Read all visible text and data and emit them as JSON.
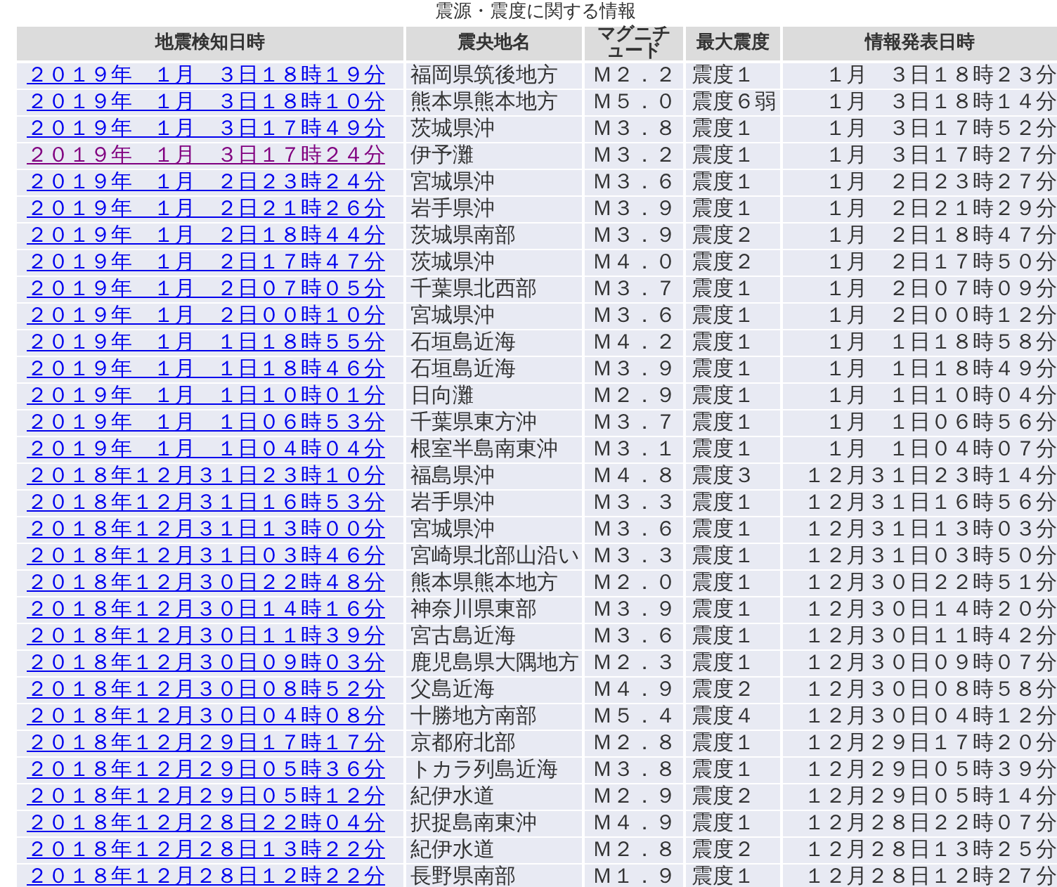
{
  "caption": "震源・震度に関する情報",
  "table": {
    "columns": [
      "地震検知日時",
      "震央地名",
      "マグニチュード",
      "最大震度",
      "情報発表日時"
    ],
    "rows": [
      {
        "detected": "２０１９年　１月　３日１８時１９分",
        "place": "福岡県筑後地方",
        "magnitude": "Ｍ２．２",
        "intensity": "震度１",
        "issued": "１月　３日１８時２３分",
        "visited": false
      },
      {
        "detected": "２０１９年　１月　３日１８時１０分",
        "place": "熊本県熊本地方",
        "magnitude": "Ｍ５．０",
        "intensity": "震度６弱",
        "issued": "１月　３日１８時１４分",
        "visited": false
      },
      {
        "detected": "２０１９年　１月　３日１７時４９分",
        "place": "茨城県沖",
        "magnitude": "Ｍ３．８",
        "intensity": "震度１",
        "issued": "１月　３日１７時５２分",
        "visited": false
      },
      {
        "detected": "２０１９年　１月　３日１７時２４分",
        "place": "伊予灘",
        "magnitude": "Ｍ３．２",
        "intensity": "震度１",
        "issued": "１月　３日１７時２７分",
        "visited": true
      },
      {
        "detected": "２０１９年　１月　２日２３時２４分",
        "place": "宮城県沖",
        "magnitude": "Ｍ３．６",
        "intensity": "震度１",
        "issued": "１月　２日２３時２７分",
        "visited": false
      },
      {
        "detected": "２０１９年　１月　２日２１時２６分",
        "place": "岩手県沖",
        "magnitude": "Ｍ３．９",
        "intensity": "震度１",
        "issued": "１月　２日２１時２９分",
        "visited": false
      },
      {
        "detected": "２０１９年　１月　２日１８時４４分",
        "place": "茨城県南部",
        "magnitude": "Ｍ３．９",
        "intensity": "震度２",
        "issued": "１月　２日１８時４７分",
        "visited": false
      },
      {
        "detected": "２０１９年　１月　２日１７時４７分",
        "place": "茨城県沖",
        "magnitude": "Ｍ４．０",
        "intensity": "震度２",
        "issued": "１月　２日１７時５０分",
        "visited": false
      },
      {
        "detected": "２０１９年　１月　２日０７時０５分",
        "place": "千葉県北西部",
        "magnitude": "Ｍ３．７",
        "intensity": "震度１",
        "issued": "１月　２日０７時０９分",
        "visited": false
      },
      {
        "detected": "２０１９年　１月　２日００時１０分",
        "place": "宮城県沖",
        "magnitude": "Ｍ３．６",
        "intensity": "震度１",
        "issued": "１月　２日００時１２分",
        "visited": false
      },
      {
        "detected": "２０１９年　１月　１日１８時５５分",
        "place": "石垣島近海",
        "magnitude": "Ｍ４．２",
        "intensity": "震度１",
        "issued": "１月　１日１８時５８分",
        "visited": false
      },
      {
        "detected": "２０１９年　１月　１日１８時４６分",
        "place": "石垣島近海",
        "magnitude": "Ｍ３．９",
        "intensity": "震度１",
        "issued": "１月　１日１８時４９分",
        "visited": false
      },
      {
        "detected": "２０１９年　１月　１日１０時０１分",
        "place": "日向灘",
        "magnitude": "Ｍ２．９",
        "intensity": "震度１",
        "issued": "１月　１日１０時０４分",
        "visited": false
      },
      {
        "detected": "２０１９年　１月　１日０６時５３分",
        "place": "千葉県東方沖",
        "magnitude": "Ｍ３．７",
        "intensity": "震度１",
        "issued": "１月　１日０６時５６分",
        "visited": false
      },
      {
        "detected": "２０１９年　１月　１日０４時０４分",
        "place": "根室半島南東沖",
        "magnitude": "Ｍ３．１",
        "intensity": "震度１",
        "issued": "１月　１日０４時０７分",
        "visited": false
      },
      {
        "detected": "２０１８年１２月３１日２３時１０分",
        "place": "福島県沖",
        "magnitude": "Ｍ４．８",
        "intensity": "震度３",
        "issued": "１２月３１日２３時１４分",
        "visited": false
      },
      {
        "detected": "２０１８年１２月３１日１６時５３分",
        "place": "岩手県沖",
        "magnitude": "Ｍ３．３",
        "intensity": "震度１",
        "issued": "１２月３１日１６時５６分",
        "visited": false
      },
      {
        "detected": "２０１８年１２月３１日１３時００分",
        "place": "宮城県沖",
        "magnitude": "Ｍ３．６",
        "intensity": "震度１",
        "issued": "１２月３１日１３時０３分",
        "visited": false
      },
      {
        "detected": "２０１８年１２月３１日０３時４６分",
        "place": "宮崎県北部山沿い",
        "magnitude": "Ｍ３．３",
        "intensity": "震度１",
        "issued": "１２月３１日０３時５０分",
        "visited": false
      },
      {
        "detected": "２０１８年１２月３０日２２時４８分",
        "place": "熊本県熊本地方",
        "magnitude": "Ｍ２．０",
        "intensity": "震度１",
        "issued": "１２月３０日２２時５１分",
        "visited": false
      },
      {
        "detected": "２０１８年１２月３０日１４時１６分",
        "place": "神奈川県東部",
        "magnitude": "Ｍ３．９",
        "intensity": "震度１",
        "issued": "１２月３０日１４時２０分",
        "visited": false
      },
      {
        "detected": "２０１８年１２月３０日１１時３９分",
        "place": "宮古島近海",
        "magnitude": "Ｍ３．６",
        "intensity": "震度１",
        "issued": "１２月３０日１１時４２分",
        "visited": false
      },
      {
        "detected": "２０１８年１２月３０日０９時０３分",
        "place": "鹿児島県大隅地方",
        "magnitude": "Ｍ２．３",
        "intensity": "震度１",
        "issued": "１２月３０日０９時０７分",
        "visited": false
      },
      {
        "detected": "２０１８年１２月３０日０８時５２分",
        "place": "父島近海",
        "magnitude": "Ｍ４．９",
        "intensity": "震度２",
        "issued": "１２月３０日０８時５８分",
        "visited": false
      },
      {
        "detected": "２０１８年１２月３０日０４時０８分",
        "place": "十勝地方南部",
        "magnitude": "Ｍ５．４",
        "intensity": "震度４",
        "issued": "１２月３０日０４時１２分",
        "visited": false
      },
      {
        "detected": "２０１８年１２月２９日１７時１７分",
        "place": "京都府北部",
        "magnitude": "Ｍ２．８",
        "intensity": "震度１",
        "issued": "１２月２９日１７時２０分",
        "visited": false
      },
      {
        "detected": "２０１８年１２月２９日０５時３６分",
        "place": "トカラ列島近海",
        "magnitude": "Ｍ３．８",
        "intensity": "震度１",
        "issued": "１２月２９日０５時３９分",
        "visited": false
      },
      {
        "detected": "２０１８年１２月２９日０５時１２分",
        "place": "紀伊水道",
        "magnitude": "Ｍ２．９",
        "intensity": "震度２",
        "issued": "１２月２９日０５時１４分",
        "visited": false
      },
      {
        "detected": "２０１８年１２月２８日２２時０４分",
        "place": "択捉島南東沖",
        "magnitude": "Ｍ４．９",
        "intensity": "震度１",
        "issued": "１２月２８日２２時０７分",
        "visited": false
      },
      {
        "detected": "２０１８年１２月２８日１３時２２分",
        "place": "紀伊水道",
        "magnitude": "Ｍ２．８",
        "intensity": "震度２",
        "issued": "１２月２８日１３時２５分",
        "visited": false
      },
      {
        "detected": "２０１８年１２月２８日１２時２２分",
        "place": "長野県南部",
        "magnitude": "Ｍ１．９",
        "intensity": "震度１",
        "issued": "１２月２８日１２時２７分",
        "visited": false
      }
    ]
  }
}
